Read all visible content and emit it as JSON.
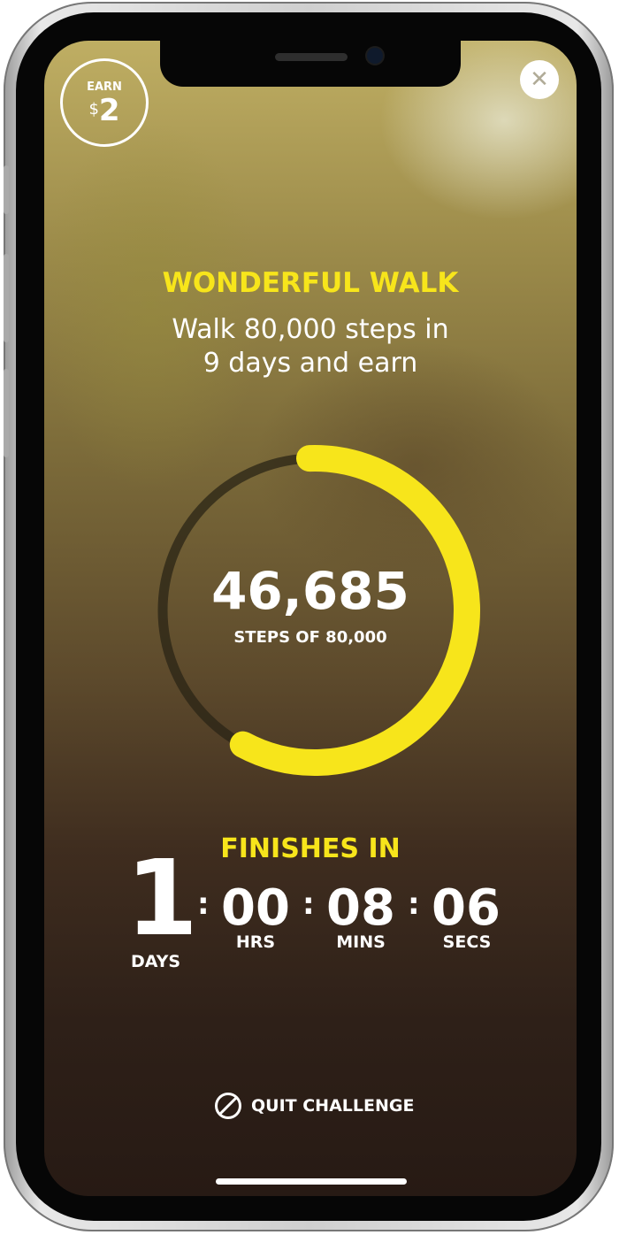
{
  "badge": {
    "label": "EARN",
    "currency": "$",
    "amount": "2"
  },
  "challenge": {
    "title": "WONDERFUL WALK",
    "description_line1": "Walk 80,000 steps in",
    "description_line2": "9 days and earn"
  },
  "progress": {
    "steps": "46,685",
    "subtitle": "STEPS OF 80,000",
    "fraction": 0.5836
  },
  "countdown": {
    "heading": "FINISHES IN",
    "days": "1",
    "days_label": "DAYS",
    "hours": "00",
    "hours_label": "HRS",
    "minutes": "08",
    "minutes_label": "MINS",
    "seconds": "06",
    "seconds_label": "SECS",
    "separator": ":"
  },
  "quit_label": "QUIT CHALLENGE",
  "colors": {
    "accent": "#f7e51b",
    "track": "#2a2416"
  }
}
